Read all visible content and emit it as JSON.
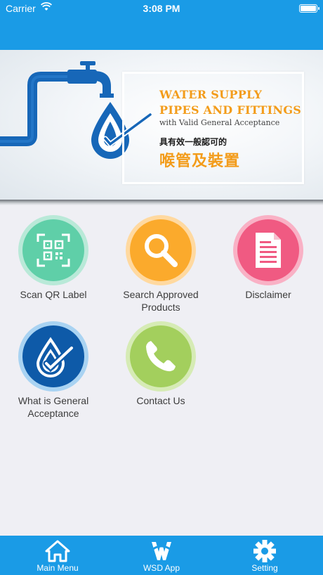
{
  "status_bar": {
    "carrier": "Carrier",
    "time": "3:08 PM"
  },
  "banner": {
    "title_line1": "WATER SUPPLY",
    "title_line2": "PIPES AND FITTINGS",
    "subtitle": "with Valid General Acceptance",
    "chinese_subtitle": "具有效一般認可的",
    "chinese_title": "喉管及裝置"
  },
  "menu": {
    "items": [
      {
        "label": "Scan QR Label",
        "icon": "qr-scan-icon",
        "ring": "#b9e9d8",
        "fill": "#5fcfa8"
      },
      {
        "label": "Search Approved Products",
        "icon": "magnifier-icon",
        "ring": "#ffd9a0",
        "fill": "#fbaa2c"
      },
      {
        "label": "Disclaimer",
        "icon": "document-icon",
        "ring": "#f9b1c5",
        "fill": "#f05a82"
      },
      {
        "label": "What is General Acceptance",
        "icon": "water-drop-icon",
        "ring": "#a9d3f2",
        "fill": "#0e5aa8"
      },
      {
        "label": "Contact Us",
        "icon": "phone-icon",
        "ring": "#d6ebb5",
        "fill": "#a3cf5d"
      }
    ]
  },
  "tabbar": {
    "tabs": [
      {
        "label": "Main Menu",
        "icon": "home-icon"
      },
      {
        "label": "WSD App",
        "icon": "wsd-logo-icon"
      },
      {
        "label": "Setting",
        "icon": "gear-icon"
      }
    ]
  },
  "colors": {
    "primary": "#1a9be6",
    "accent_orange": "#f39c1a",
    "pipe_blue": "#1565c0"
  }
}
